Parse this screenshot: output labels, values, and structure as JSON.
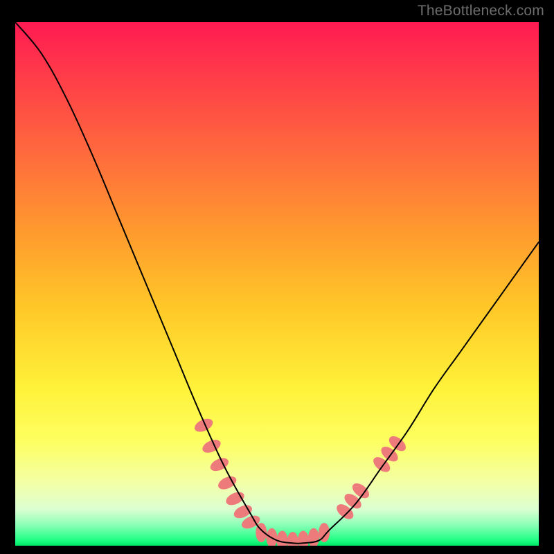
{
  "watermark": "TheBottleneck.com",
  "chart_data": {
    "type": "line",
    "title": "",
    "xlabel": "",
    "ylabel": "",
    "xlim": [
      0,
      100
    ],
    "ylim": [
      0,
      100
    ],
    "series": [
      {
        "name": "curve",
        "x": [
          0,
          5,
          10,
          15,
          20,
          25,
          30,
          35,
          40,
          45,
          47,
          50,
          53,
          55,
          58,
          60,
          65,
          70,
          75,
          80,
          85,
          90,
          95,
          100
        ],
        "values": [
          100,
          94,
          85,
          74,
          62,
          50,
          38,
          26,
          15,
          6,
          3,
          1,
          0.5,
          0.5,
          1,
          3,
          8,
          15,
          22,
          30,
          37,
          44,
          51,
          58
        ]
      }
    ],
    "markers": {
      "comment": "pink highlight blobs near the valley and its walls",
      "points": [
        {
          "x": 36,
          "y": 23
        },
        {
          "x": 37.5,
          "y": 19
        },
        {
          "x": 39,
          "y": 15.5
        },
        {
          "x": 40.5,
          "y": 12
        },
        {
          "x": 42,
          "y": 9
        },
        {
          "x": 43.5,
          "y": 6.5
        },
        {
          "x": 45,
          "y": 4.5
        },
        {
          "x": 47,
          "y": 2.5
        },
        {
          "x": 49,
          "y": 1.5
        },
        {
          "x": 51,
          "y": 1
        },
        {
          "x": 53,
          "y": 0.8
        },
        {
          "x": 55,
          "y": 1
        },
        {
          "x": 57,
          "y": 1.5
        },
        {
          "x": 59,
          "y": 2.5
        },
        {
          "x": 63,
          "y": 6.5
        },
        {
          "x": 64.5,
          "y": 8.5
        },
        {
          "x": 66,
          "y": 10.5
        },
        {
          "x": 70,
          "y": 15.5
        },
        {
          "x": 71.5,
          "y": 17.5
        },
        {
          "x": 73,
          "y": 19.5
        }
      ]
    },
    "colors": {
      "curve": "#000000",
      "markers": "#ee7b7b",
      "gradient_top": "#ff1a52",
      "gradient_mid": "#fff23a",
      "gradient_bottom": "#00e667"
    }
  }
}
